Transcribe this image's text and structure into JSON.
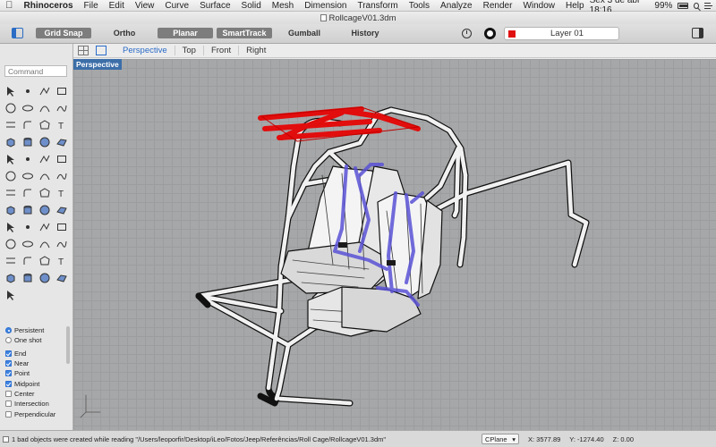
{
  "menubar": {
    "items": [
      "Rhinoceros",
      "File",
      "Edit",
      "View",
      "Curve",
      "Surface",
      "Solid",
      "Mesh",
      "Dimension",
      "Transform",
      "Tools",
      "Analyze",
      "Render",
      "Window",
      "Help"
    ],
    "clock": "Sex 3 de abr  18:16",
    "battery": "99%"
  },
  "window": {
    "title": "RollcageV01.3dm"
  },
  "toolbar": {
    "grid_snap": "Grid Snap",
    "ortho": "Ortho",
    "planar": "Planar",
    "smarttrack": "SmartTrack",
    "gumball": "Gumball",
    "history": "History",
    "layer": "Layer 01",
    "layer_color": "#e01010"
  },
  "viewtabs": {
    "tabs": [
      "Perspective",
      "Top",
      "Front",
      "Right"
    ],
    "active": "Perspective"
  },
  "viewport": {
    "label": "Perspective",
    "background": "#a6a7a8"
  },
  "command": {
    "placeholder": "Command"
  },
  "tools": [
    "select-arrow-icon",
    "point-icon",
    "polyline-icon",
    "rectangle-icon",
    "circle-icon",
    "ellipse-icon",
    "arc-icon",
    "freeform-curve-icon",
    "offset-icon",
    "fillet-curve-icon",
    "polygon-icon",
    "text-icon",
    "box-icon",
    "cylinder-icon",
    "sphere-icon",
    "surface-icon",
    "extrude-icon",
    "surface-edit-icon",
    "loft-icon",
    "network-srf-icon",
    "boolean-icon",
    "trim-icon",
    "split-icon",
    "join-icon",
    "transform-icon",
    "array-icon",
    "group-icon",
    "explode-icon",
    "dimension-icon",
    "mirror-icon",
    "rotate-icon",
    "move-icon",
    "check-icon",
    "scale-icon",
    "align-icon",
    "project-icon",
    "zoom-icon",
    "zoom-window-icon",
    "zoom-extents-icon",
    "analyze-icon",
    "render-icon",
    "light-icon",
    "material-icon",
    "color-wheel-icon",
    "shade-icon",
    "rendered-view-icon",
    "ghost-view-icon",
    "annotation-icon",
    "block-icon"
  ],
  "osnap": {
    "modes": [
      {
        "label": "Persistent",
        "on": true
      },
      {
        "label": "One shot",
        "on": false
      }
    ],
    "snaps": [
      {
        "label": "End",
        "on": true
      },
      {
        "label": "Near",
        "on": true
      },
      {
        "label": "Point",
        "on": true
      },
      {
        "label": "Midpoint",
        "on": true
      },
      {
        "label": "Center",
        "on": false
      },
      {
        "label": "Intersection",
        "on": false
      },
      {
        "label": "Perpendicular",
        "on": false
      }
    ]
  },
  "status": {
    "message": "1 bad objects were created while reading \"/Users/leoporfir/Desktop/iLeo/Fotos/Jeep/Referências/Roll Cage/RollcageV01.3dm\"",
    "cplane": "CPlane",
    "x": "X: 3577.89",
    "y": "Y: -1274.40",
    "z": "Z: 0.00"
  }
}
